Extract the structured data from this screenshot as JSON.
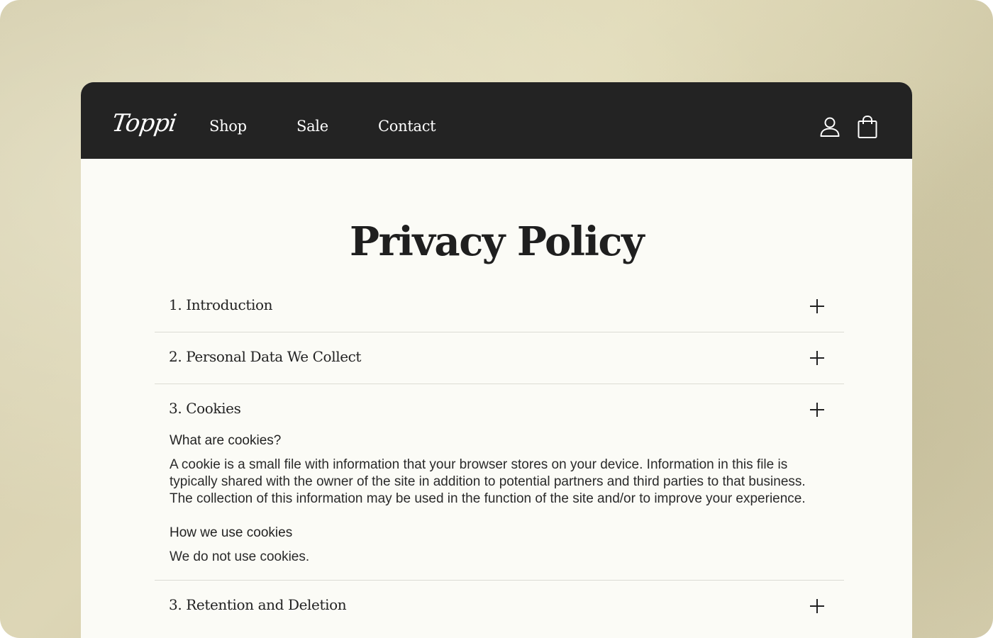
{
  "nav": {
    "logo": "Toppi",
    "links": [
      "Shop",
      "Sale",
      "Contact"
    ],
    "account_icon": "user-icon",
    "cart_icon": "shopping-bag-icon"
  },
  "page": {
    "title": "Privacy Policy"
  },
  "accordion": {
    "items": [
      {
        "title": "1. Introduction",
        "expanded": false
      },
      {
        "title": "2. Personal Data We Collect",
        "expanded": false
      },
      {
        "title": "3. Cookies",
        "expanded": true,
        "sections": [
          {
            "heading": "What are cookies?",
            "text": "A cookie is a small file with information that your browser stores on your device. Information in this file is typically shared with the owner of the site in addition to potential partners and third parties to that business. The collection of this information may be used in the function of the site and/or to improve your experience."
          },
          {
            "heading": "How we use cookies",
            "text": "We do not use cookies."
          }
        ]
      },
      {
        "title": "3. Retention and Deletion",
        "expanded": false
      }
    ]
  },
  "colors": {
    "navbar": "#232323",
    "page_background": "#fbfbf6",
    "text": "#222222",
    "divider": "#dcdcd4"
  }
}
